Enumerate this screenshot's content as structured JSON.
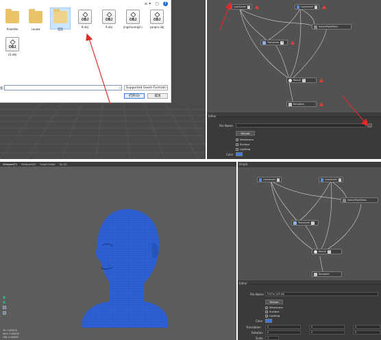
{
  "top": {
    "dialog": {
      "toolbar_view": "≡ ▾",
      "toolbar_pane": "▢",
      "help": "?",
      "files": [
        {
          "name": "Anaerbo",
          "kind": "folder"
        },
        {
          "name": "cuuaw",
          "kind": "folder"
        },
        {
          "name": "酸路",
          "kind": "folder",
          "selected": true
        },
        {
          "name": "8.obj",
          "kind": "obj"
        },
        {
          "name": "9.obj",
          "kind": "obj"
        },
        {
          "name": "jingshuangzi.obj",
          "kind": "obj"
        },
        {
          "name": "yanpiu.obj",
          "kind": "obj"
        },
        {
          "name": "z1.obj",
          "kind": "obj"
        }
      ],
      "obj_badge": "OBJ",
      "filename_label": "名:",
      "filename_value": "",
      "dropdown_arrow": "⌄",
      "format_select": "Supported Geom Formats (*.",
      "open_button": "打开(O)",
      "cancel_button": "取消"
    },
    "node_graph": {
      "nodes": {
        "load_a": "LoadLevel",
        "load_b": "LoadLevel",
        "select": "SelectPointPairs",
        "transform": "Transform",
        "result": "Result",
        "renderer": "Renderer"
      },
      "node_btn": "?"
    },
    "props": {
      "panel_title": "Editor",
      "file_name_label": "File Name",
      "file_name_value": "",
      "browse": "...",
      "reload": "Reload",
      "wireframe": "Wireframe",
      "surface": "Surface",
      "lighting": "Lighting",
      "color_label": "Color",
      "check": "✓"
    }
  },
  "bottom": {
    "viewport": {
      "tabs": [
        "Viewport(T)",
        "Viewport(B)",
        "Graph Editor",
        "Vp (Z)"
      ],
      "stats_lines": [
        "Tri: 0.00000",
        "Vert: 0.00000",
        "Obj: 0.00000"
      ]
    },
    "graph_title": "Graph",
    "node_graph": {
      "nodes": {
        "load_a": "LoadLevel",
        "load_b": "LoadLevel",
        "select": "SelectPointPairs",
        "transform": "Transform",
        "result": "Result",
        "renderer": "Renderer"
      },
      "node_btn": "?"
    },
    "props": {
      "panel_title": "Editor",
      "file_name_label": "File Name",
      "file_name_value": "D:/Our_b/k.obj",
      "reload": "Reload",
      "wireframe": "Wireframe",
      "surface": "Surface",
      "lighting": "Lighting",
      "color_label": "Color",
      "translation_label": "Translation",
      "rotation_label": "Rotation",
      "scale_label": "Scale",
      "translation": [
        "0",
        "0",
        "0"
      ],
      "rotation": [
        "0",
        "0",
        "0"
      ],
      "scale": [
        "1",
        "",
        ""
      ],
      "check": "✓"
    }
  },
  "colors": {
    "accent_blue": "#3d7be0",
    "arrow_red": "#e02a2a",
    "mesh_blue": "#2f62d6"
  }
}
